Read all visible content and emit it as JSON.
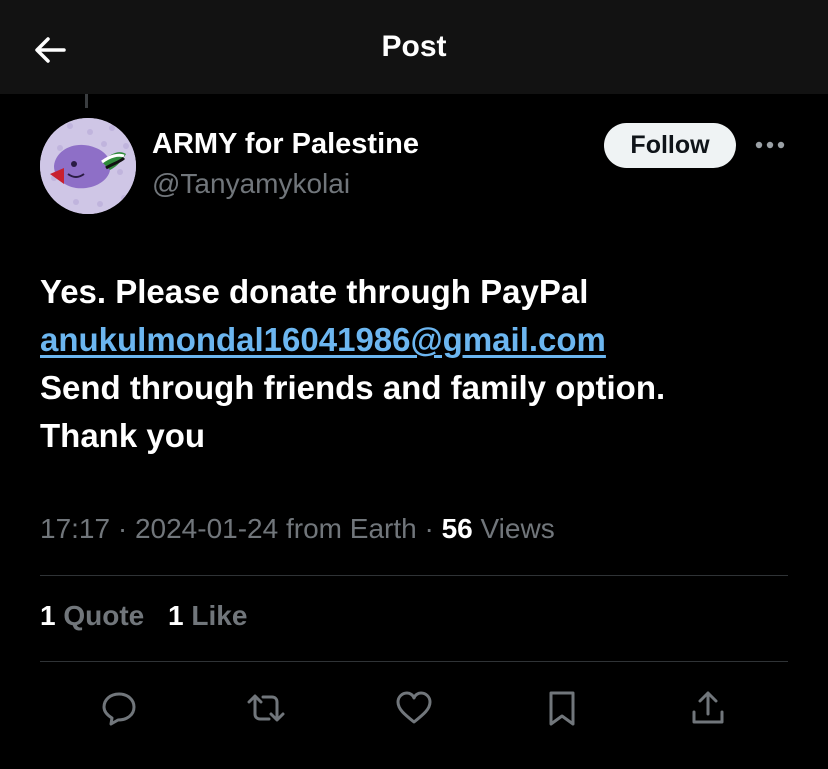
{
  "header": {
    "title": "Post",
    "back_icon": "arrow-left-icon"
  },
  "author": {
    "display_name": "ARMY for Palestine",
    "handle": "@Tanyamykolai",
    "follow_label": "Follow",
    "more_icon": "more-horizontal-icon"
  },
  "post": {
    "line1": "Yes. Please donate through PayPal",
    "email": "anukulmondal16041986@gmail.com",
    "line3": "Send through friends and family option.",
    "line4": "Thank you"
  },
  "meta": {
    "time": "17:17",
    "date": "2024-01-24",
    "location": "from Earth",
    "separator": "·",
    "views_count": "56",
    "views_label": "Views"
  },
  "stats": {
    "quote_count": "1",
    "quote_label": "Quote",
    "like_count": "1",
    "like_label": "Like"
  },
  "actions": [
    "reply-icon",
    "repost-icon",
    "like-icon",
    "bookmark-icon",
    "share-icon"
  ],
  "colors": {
    "background": "#000000",
    "link": "#6cb6f0",
    "muted": "#71767b",
    "avatar_bg": "#cfc6e6"
  }
}
